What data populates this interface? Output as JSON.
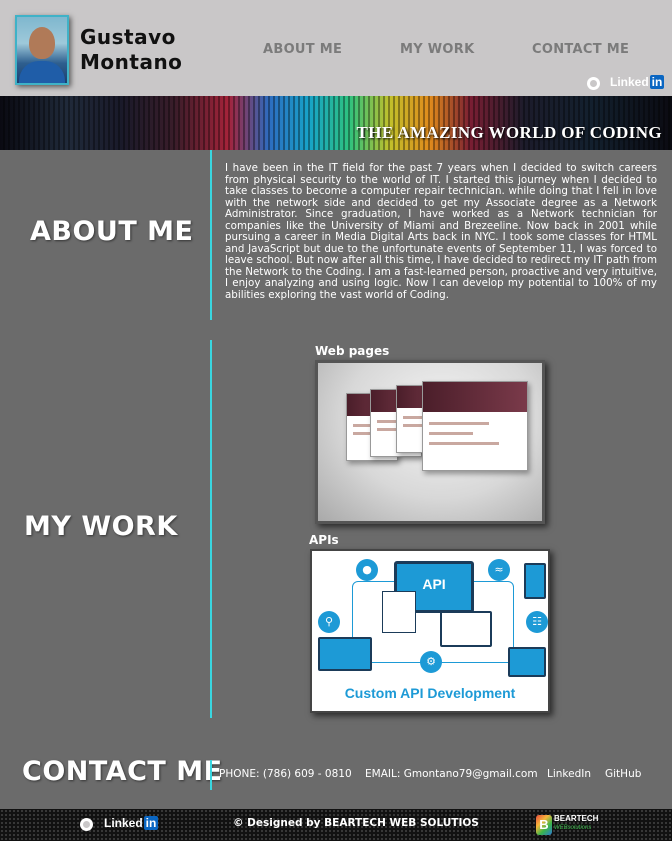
{
  "header": {
    "name_line1": "Gustavo",
    "name_line2": "Montano",
    "nav": [
      "ABOUT ME",
      "MY WORK",
      "CONTACT ME"
    ],
    "social": {
      "github_icon": "github-icon",
      "linkedin_text": "Linked",
      "linkedin_box": "in"
    }
  },
  "banner": {
    "title": "THE AMAZING WORLD OF CODING"
  },
  "about": {
    "title": "ABOUT ME",
    "text": "I have been in the IT field for the past  7 years when I decided to switch careers from physical security to the world of IT. I started this journey when I decided to take classes to become a computer repair technician. while doing that I fell in love with the network side and decided to get my Associate degree as a Network Administrator. Since graduation, I have worked as a Network technician for companies like the University of Miami and Brezeeline.  Now back in 2001 while pursuing a career in Media Digital Arts back in NYC. I took some classes for HTML and JavaScript but due to the unfortunate events of September 11, I was forced to leave school. But now after all this time, I have decided to redirect my IT path from the Network to the Coding. I am a fast-learned person, proactive and very intuitive, I enjoy analyzing and using logic. Now I can develop my potential to 100% of my abilities exploring the vast world of Coding."
  },
  "work": {
    "title": "MY WORK",
    "items": [
      {
        "label": "Web pages"
      },
      {
        "label": "APIs",
        "image_caption": "Custom API Development",
        "image_box": "API"
      }
    ]
  },
  "contact": {
    "title": "CONTACT ME",
    "phone": "PHONE: (786) 609 - 0810",
    "email": "EMAIL: Gmontano79@gmail.com",
    "linkedin": "LinkedIn",
    "github": "GitHub"
  },
  "footer": {
    "linkedin_text": "Linked",
    "linkedin_box": "in",
    "credit": "© Designed by BEARTECH WEB SOLUTIOS",
    "brand_name": "BEARTECH",
    "brand_sub": "WEBsolutions",
    "brand_letter": "B"
  },
  "colors": {
    "accent": "#39d6e0",
    "header_bg": "#c9c7c8",
    "body_bg": "#6b6b6b",
    "linkedin_blue": "#0a66c2",
    "api_blue": "#1d9ad6"
  }
}
